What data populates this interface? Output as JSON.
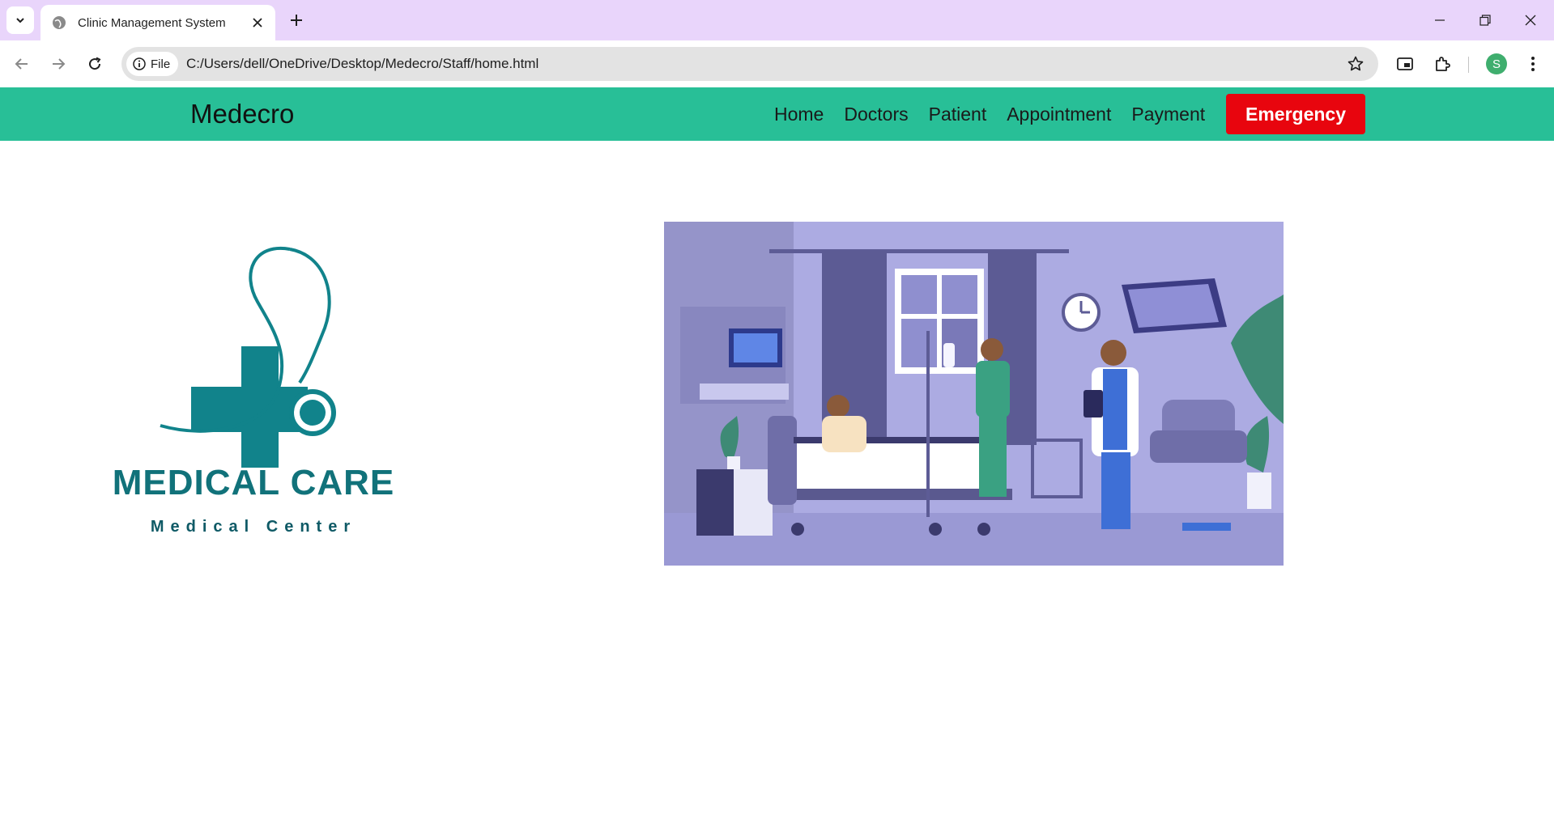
{
  "browser": {
    "tab_title": "Clinic Management System",
    "site_chip_label": "File",
    "url": "C:/Users/dell/OneDrive/Desktop/Medecro/Staff/home.html",
    "profile_initial": "S"
  },
  "site": {
    "brand": "Medecro",
    "nav": [
      "Home",
      "Doctors",
      "Patient",
      "Appointment",
      "Payment"
    ],
    "emergency_label": "Emergency"
  },
  "logo": {
    "title": "MEDICAL CARE",
    "subtitle": "Medical Center"
  },
  "colors": {
    "nav_bg": "#28bf97",
    "emergency_bg": "#e8050e",
    "logo_teal": "#11727a",
    "tabbar_bg": "#e9d5fb",
    "hero_bg": "#a9a8e0"
  }
}
